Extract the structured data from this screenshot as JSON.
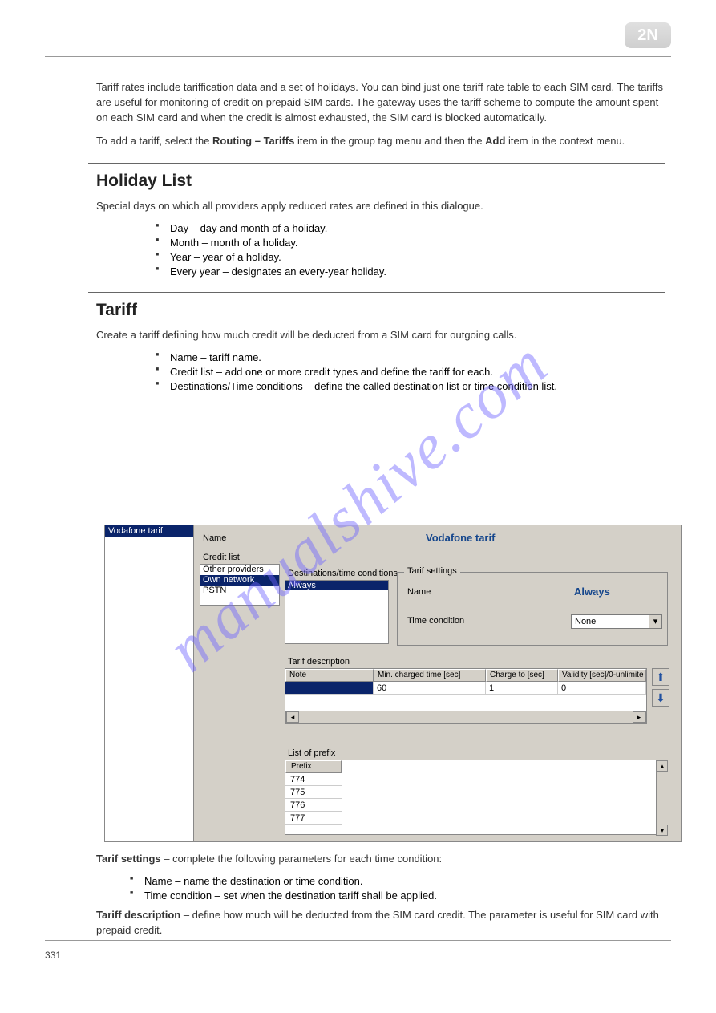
{
  "logo": "2N",
  "watermark": "manualshive.com",
  "para_intro": "Tariff rates include tariffication data and a set of holidays. You can bind just one tariff rate table to each SIM card. The tariffs are useful for monitoring of credit on prepaid SIM cards. The gateway uses the tariff scheme to compute the amount spent on each SIM card and when the credit is almost exhausted, the SIM card is blocked automatically.",
  "para_add_prefix": "To add a tariff, select the",
  "para_add_bold": "Routing – Tariffs",
  "para_add_suffix": "item in the group tag menu and then the",
  "para_add_bold2": "Add",
  "para_add_suffix2": "item in the context menu.",
  "h_holidays": "Holiday List",
  "para_holidays": "Special days on which all providers apply reduced rates are defined in this dialogue.",
  "holidays_list": [
    "Day – day and month of a holiday.",
    "Month – month of a holiday.",
    "Year – year of a holiday.",
    "Every year – designates an every-year holiday."
  ],
  "h_tariff": "Tariff",
  "para_tariff": "Create a tariff defining how much credit will be deducted from a SIM card for outgoing calls.",
  "tariff_list": [
    "Name – tariff name.",
    "Credit list – add one or more credit types and define the tariff for each.",
    "Destinations/Time conditions – define the called destination list or time condition list."
  ],
  "screenshot": {
    "left_selected": "Vodafone tarif",
    "name_label": "Name",
    "name_value": "Vodafone tarif",
    "credit_label": "Credit list",
    "credit_items": [
      "Other providers",
      "Own network",
      "PSTN"
    ],
    "credit_selected_index": 1,
    "dest_label": "Destinations/time conditions",
    "dest_item": "Always",
    "tarif_group_title": "Tarif settings",
    "tarif_name_label": "Name",
    "tarif_name_value": "Always",
    "tarif_tc_label": "Time condition",
    "tarif_tc_value": "None",
    "td_label": "Tarif description",
    "td_headers": [
      "Note",
      "Min. charged time [sec]",
      "Charge to [sec]",
      "Validity [sec]/0-unlimite"
    ],
    "td_row": [
      "",
      "60",
      "1",
      "0"
    ],
    "lop_label": "List of prefix",
    "lop_header": "Prefix",
    "lop_rows": [
      "774",
      "775",
      "776",
      "777"
    ]
  },
  "para_after_1_prefix": "Tarif settings",
  "para_after_1_body": " – complete the following parameters for each time condition:",
  "after_list_1": [
    "Name – name the destination or time condition.",
    "Time condition – set when the destination tariff shall be applied."
  ],
  "para_after_2_prefix": "Tariff description",
  "para_after_2_body": " – define how much will be deducted from the SIM card credit. The parameter is useful for SIM card with prepaid credit.",
  "footer_page": "331"
}
